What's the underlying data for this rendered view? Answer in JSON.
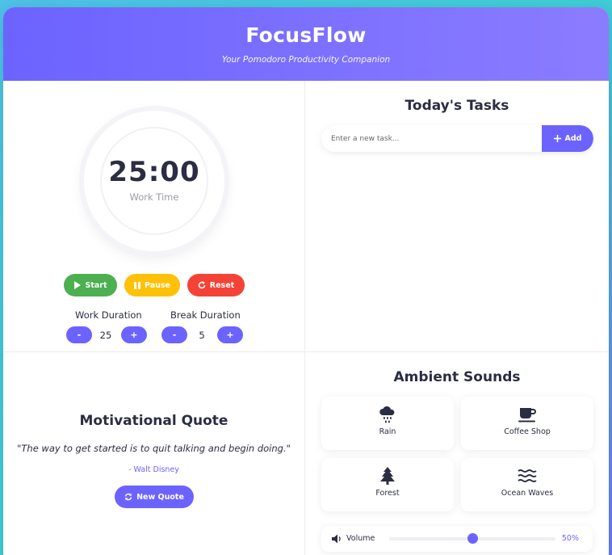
{
  "app": {
    "title": "FocusFlow",
    "subtitle": "Your Pomodoro Productivity Companion"
  },
  "timer": {
    "time": "25:00",
    "mode": "Work Time",
    "start_label": "Start",
    "pause_label": "Pause",
    "reset_label": "Reset",
    "work_label": "Work Duration",
    "work_value": "25",
    "break_label": "Break Duration",
    "break_value": "5",
    "minus": "-",
    "plus": "+"
  },
  "tasks": {
    "title": "Today's Tasks",
    "placeholder": "Enter a new task...",
    "add_label": "Add",
    "items": []
  },
  "quote": {
    "title": "Motivational Quote",
    "text": "\"The way to get started is to quit talking and begin doing.\"",
    "author": "- Walt Disney",
    "button_label": "New Quote"
  },
  "sounds": {
    "title": "Ambient Sounds",
    "items": [
      {
        "label": "Rain",
        "icon": "cloud-rain-icon"
      },
      {
        "label": "Coffee Shop",
        "icon": "coffee-icon"
      },
      {
        "label": "Forest",
        "icon": "tree-icon"
      },
      {
        "label": "Ocean Waves",
        "icon": "water-icon"
      }
    ],
    "volume_label": "Volume",
    "volume_value": "50%",
    "volume_level": 0.5
  },
  "colors": {
    "accent": "#6c63ff",
    "start": "#4caf50",
    "pause": "#ffc107",
    "reset": "#f44336",
    "text": "#2b2d42"
  }
}
